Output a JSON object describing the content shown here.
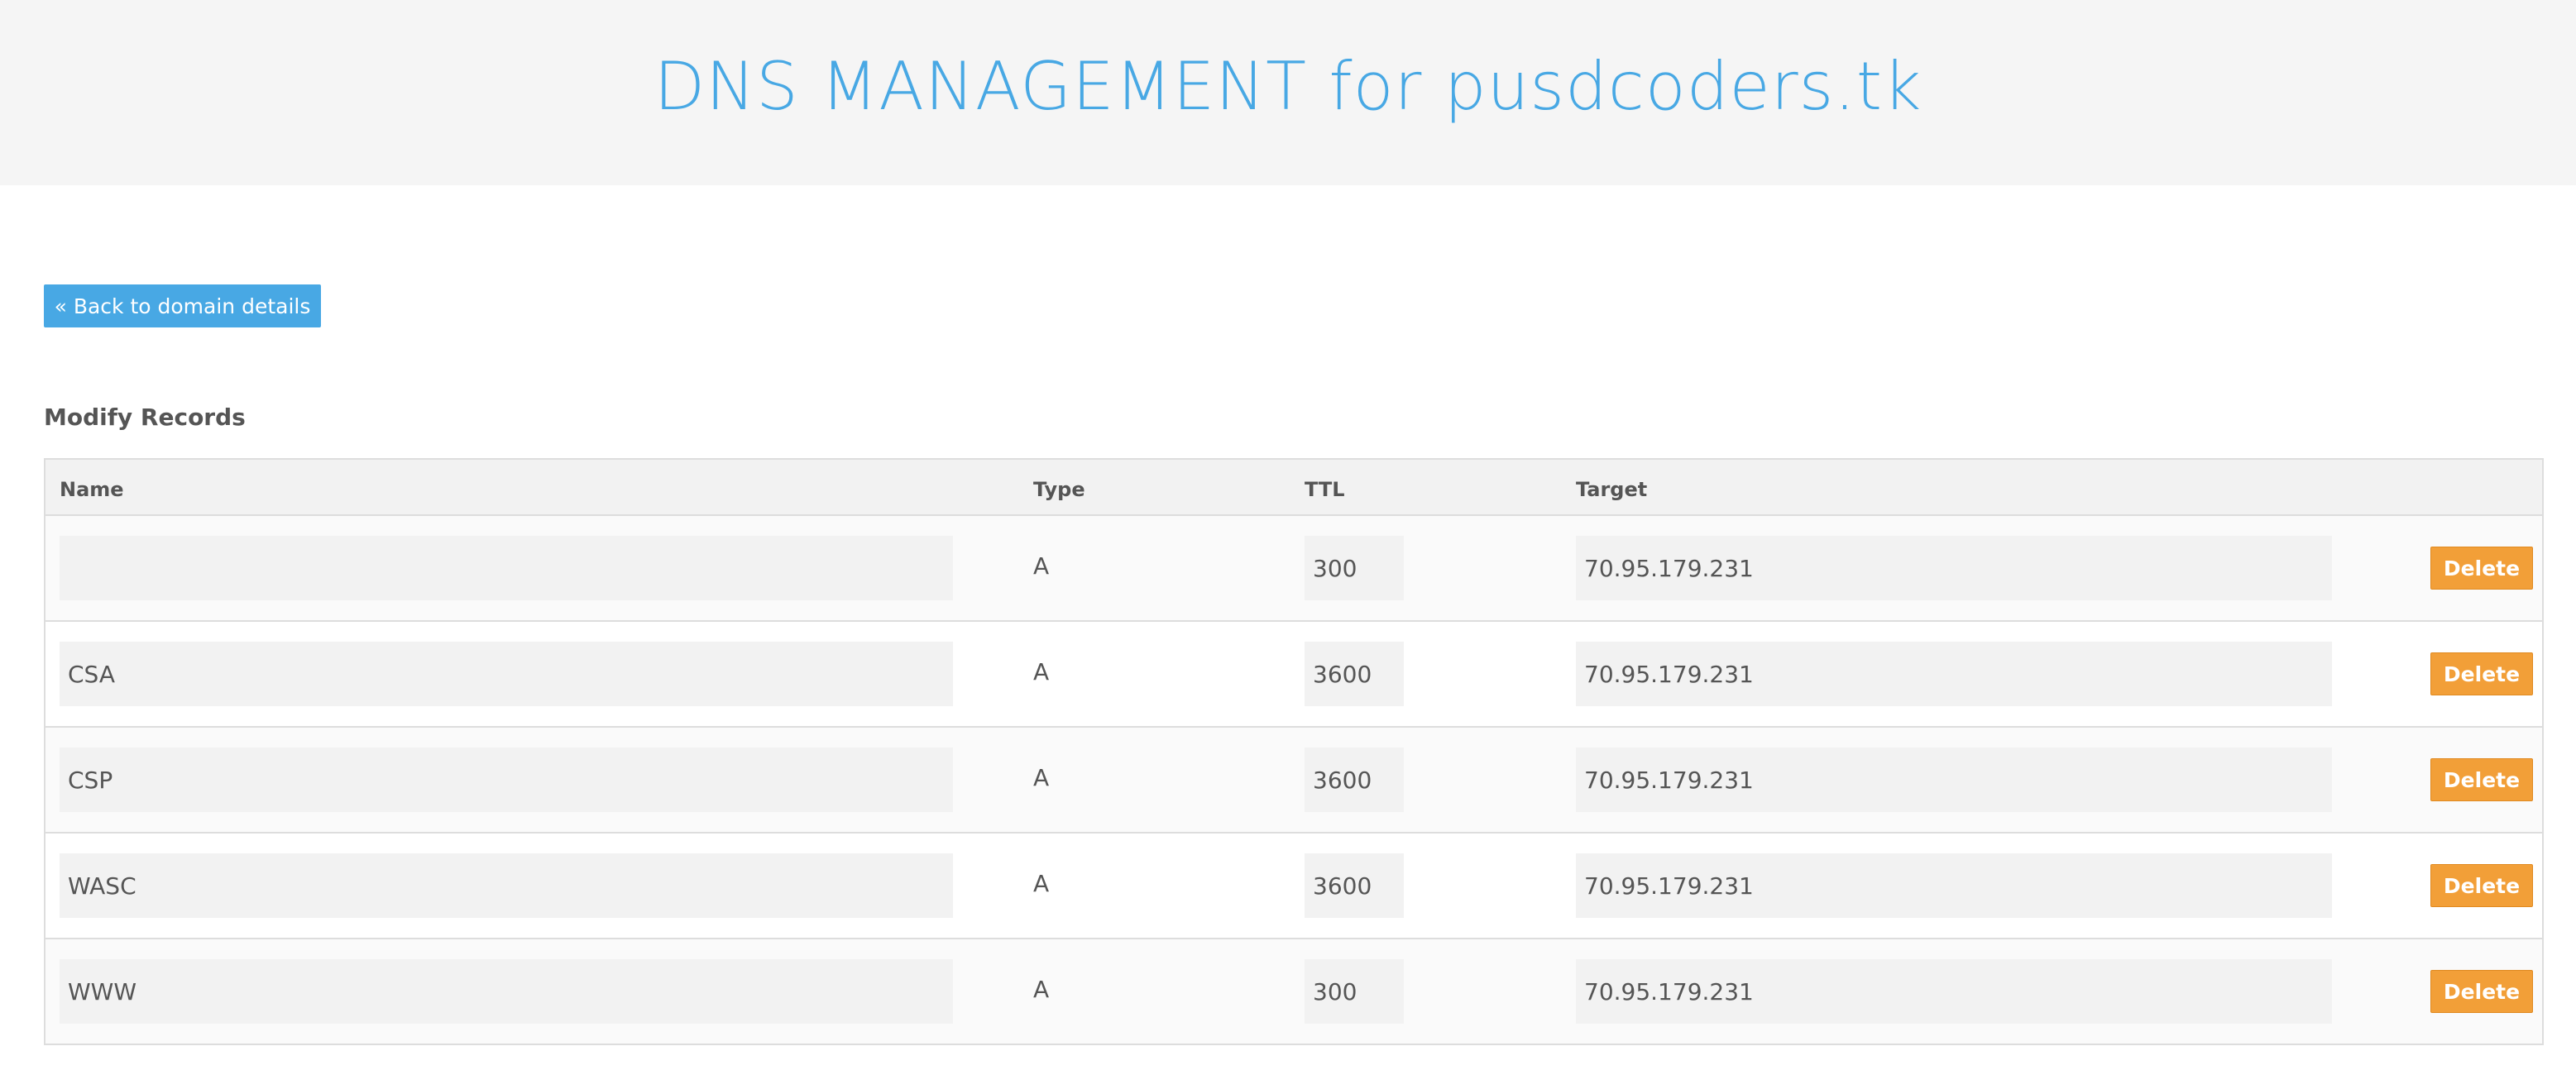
{
  "header": {
    "title": "DNS MANAGEMENT for pusdcoders.tk"
  },
  "back_button": {
    "label": "« Back to domain details"
  },
  "section": {
    "title": "Modify Records"
  },
  "table": {
    "columns": [
      "Name",
      "Type",
      "TTL",
      "Target"
    ],
    "rows": [
      {
        "name": "",
        "type": "A",
        "ttl": "300",
        "target": "70.95.179.231",
        "action": "Delete"
      },
      {
        "name": "CSA",
        "type": "A",
        "ttl": "3600",
        "target": "70.95.179.231",
        "action": "Delete"
      },
      {
        "name": "CSP",
        "type": "A",
        "ttl": "3600",
        "target": "70.95.179.231",
        "action": "Delete"
      },
      {
        "name": "WASC",
        "type": "A",
        "ttl": "3600",
        "target": "70.95.179.231",
        "action": "Delete"
      },
      {
        "name": "WWW",
        "type": "A",
        "ttl": "300",
        "target": "70.95.179.231",
        "action": "Delete"
      }
    ]
  },
  "colors": {
    "accent": "#48a8e4",
    "delete": "#f29f38",
    "header_bg": "#f5f5f5"
  }
}
